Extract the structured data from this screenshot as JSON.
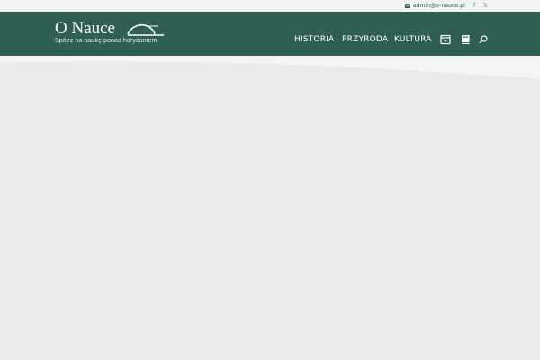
{
  "topbar": {
    "contact_email": "admin@o-nauce.pl",
    "mail_icon": "envelope-icon",
    "social_icons": [
      "facebook-icon",
      "x-twitter-icon"
    ]
  },
  "header": {
    "logo_title": "O Nauce",
    "logo_tagline": "Spójrz na naukę ponad horyzontem",
    "background_color": "#2f5e55"
  },
  "nav": {
    "items": [
      {
        "label": "HISTORIA"
      },
      {
        "label": "PRZYRODA"
      },
      {
        "label": "KULTURA"
      }
    ],
    "icons": [
      "video-icon",
      "book-icon",
      "search-icon"
    ]
  },
  "colors": {
    "accent": "#2f5e55",
    "page_bg": "#e9eaeb",
    "topbar_bg": "#f2f3f3"
  }
}
